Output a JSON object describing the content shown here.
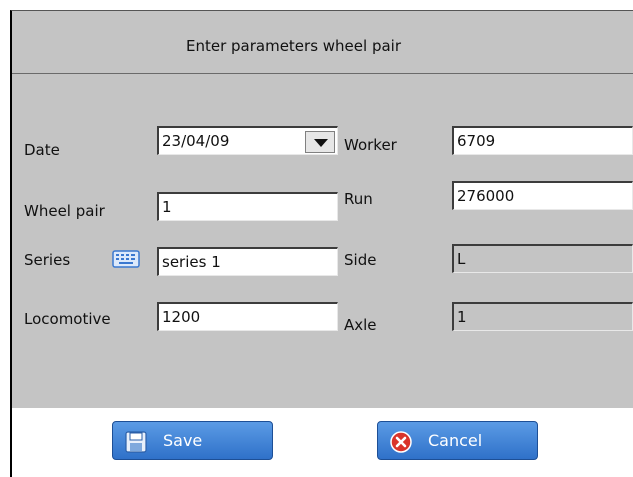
{
  "dialog": {
    "title": "Enter parameters wheel pair"
  },
  "left": {
    "date_label": "Date",
    "date_value": "23/04/09",
    "wheel_pair_label": "Wheel pair",
    "wheel_pair_value": "1",
    "series_label": "Series",
    "series_value": "series 1",
    "locomotive_label": "Locomotive",
    "locomotive_value": "1200"
  },
  "right": {
    "worker_label": "Worker",
    "worker_value": "6709",
    "run_label": "Run",
    "run_value": "276000",
    "side_label": "Side",
    "side_value": "L",
    "axle_label": "Axle",
    "axle_value": "1"
  },
  "buttons": {
    "save_label": "Save",
    "cancel_label": "Cancel"
  },
  "icons": {
    "dropdown": "chevron-down-icon",
    "keyboard": "keyboard-icon",
    "save": "floppy-disk-icon",
    "cancel": "close-circle-icon"
  },
  "colors": {
    "panel": "#c4c4c4",
    "button": "#3f82d6",
    "cancel_icon": "#d9342b"
  }
}
